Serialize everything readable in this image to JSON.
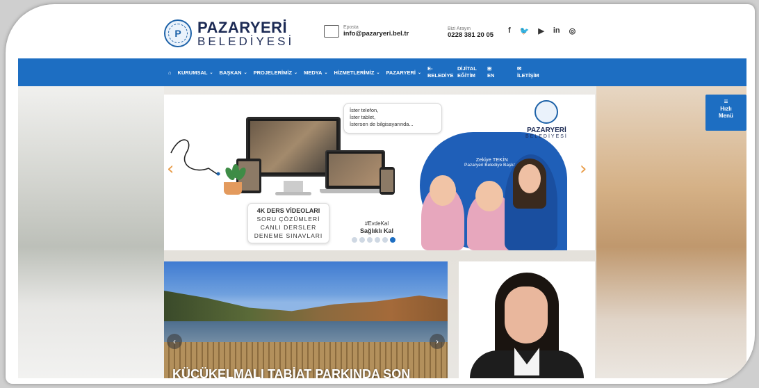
{
  "header": {
    "logo_name": "PAZARYERİ",
    "logo_sub": "BELEDİYESİ",
    "email_label": "Eposta",
    "email_value": "info@pazaryeri.bel.tr",
    "phone_label": "Bizi Arayın",
    "phone_value": "0228 381 20 05",
    "socials": [
      "f",
      "🐦",
      "▶",
      "in",
      "◎"
    ]
  },
  "nav": {
    "home_icon": "⌂",
    "items": [
      {
        "label": "KURUMSAL",
        "chevron": true
      },
      {
        "label": "BAŞKAN",
        "chevron": true
      },
      {
        "label": "PROJELERİMİZ",
        "chevron": true
      },
      {
        "label": "MEDYA",
        "chevron": true
      },
      {
        "label": "HİZMETLERİMİZ",
        "chevron": true
      },
      {
        "label": "PAZARYERİ",
        "chevron": true
      },
      {
        "label": "E-\nBELEDİYE",
        "chevron": false
      },
      {
        "label": "DİJİTAL\nEĞİTİM",
        "chevron": false
      },
      {
        "label": "⊞\nEN",
        "chevron": false
      },
      {
        "label": "✉\nİLETİŞİM",
        "chevron": false
      }
    ]
  },
  "quick_menu": {
    "icon": "≡",
    "line1": "Hızlı",
    "line2": "Menü"
  },
  "slider": {
    "bubble_lines": [
      "İster telefon,",
      "İster tablet,",
      "İstersen de bilgisayarında..."
    ],
    "lesson_lines": [
      "4K DERS VİDEOLARI",
      "SORU ÇÖZÜMLERİ",
      "CANLI DERSLER",
      "DENEME SINAVLARI"
    ],
    "hashtag": "#EvdeKal",
    "hashtag_sub": "Sağlıklı Kal",
    "person_name": "Zekiye TEKİN",
    "person_title": "Pazaryeri Belediye Başkanı",
    "logo_name": "PAZARYERİ",
    "logo_sub": "BELEDİYESİ",
    "dots_total": 6,
    "dots_active": 6
  },
  "news": {
    "caption": "KÜÇÜKELMALI TABİAT PARKINDA SON"
  },
  "colors": {
    "brand_blue": "#1d6ec2",
    "accent_orange": "#e89b47"
  }
}
